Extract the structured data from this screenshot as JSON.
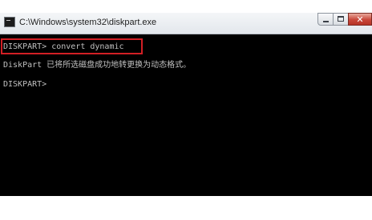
{
  "window": {
    "title": "C:\\Windows\\system32\\diskpart.exe",
    "icon": "console-icon",
    "controls": {
      "minimize_icon": "minimize-icon",
      "maximize_icon": "maximize-icon",
      "close_icon": "close-icon",
      "close_glyph": "✕"
    }
  },
  "console": {
    "lines": [
      "DISKPART> convert dynamic",
      "DiskPart 已将所选磁盘成功地转更换为动态格式。",
      "DISKPART>"
    ],
    "highlight_color": "#d21f25",
    "background_color": "#000000",
    "text_color": "#c0c0c0"
  }
}
